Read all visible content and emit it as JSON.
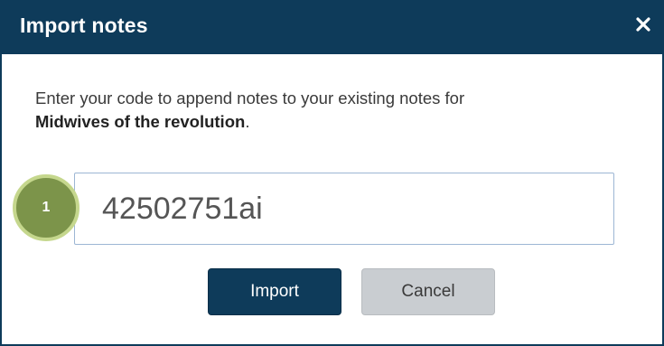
{
  "dialog": {
    "title": "Import notes",
    "close_symbol": "×",
    "message_prefix": "Enter your code to append notes to your existing notes for",
    "book_title": "Midwives of the revolution",
    "message_suffix": "."
  },
  "code_input": {
    "value": "42502751ai"
  },
  "step_badge": {
    "number": "1"
  },
  "buttons": {
    "import_label": "Import",
    "cancel_label": "Cancel"
  },
  "colors": {
    "title_bar": "#0e3b5a",
    "import_button": "#0e3b5a",
    "cancel_button": "#c9cdd1",
    "badge": "#7c944a",
    "badge_ring": "#c5d78d"
  },
  "icons": {
    "close": "close-icon"
  }
}
